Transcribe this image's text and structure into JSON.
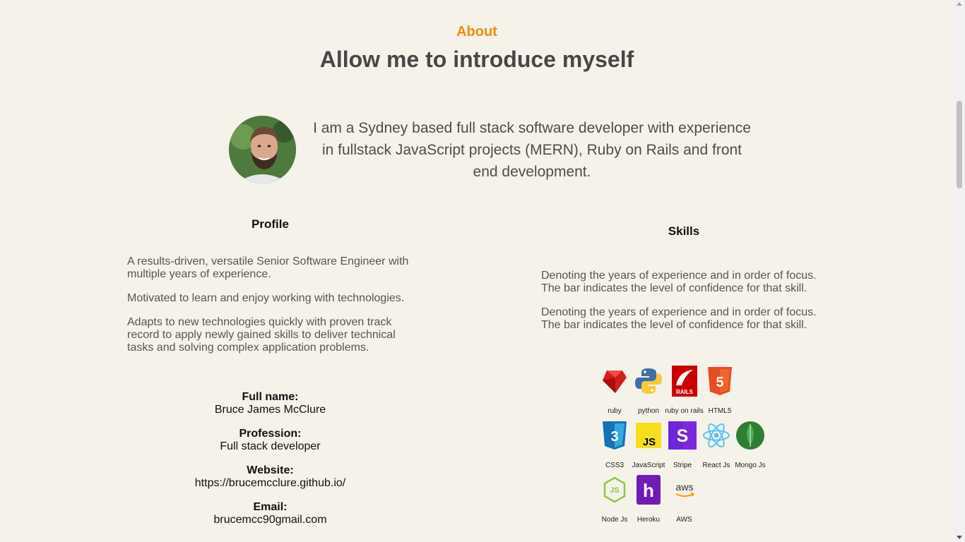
{
  "about": {
    "eyebrow": "About",
    "title": "Allow me to introduce myself",
    "intro": "I am a Sydney based full stack software developer with experience in fullstack JavaScript projects (MERN), Ruby on Rails and front end development."
  },
  "profile": {
    "heading": "Profile",
    "paragraphs": [
      "A results-driven, versatile Senior Software Engineer with multiple years of experience.",
      "Motivated to learn and enjoy working with technologies.",
      "Adapts to new technologies quickly with proven track record to apply newly gained skills to deliver technical tasks and solving complex application problems."
    ],
    "details": [
      {
        "label": "Full name:",
        "value": "Bruce James McClure"
      },
      {
        "label": "Profession:",
        "value": "Full stack developer"
      },
      {
        "label": "Website:",
        "value": "https://brucemcclure.github.io/"
      },
      {
        "label": "Email:",
        "value": "brucemcc90gmail.com"
      }
    ]
  },
  "skills": {
    "heading": "Skills",
    "paragraphs": [
      "Denoting the years of experience and in order of focus. The bar indicates the level of confidence for that skill.",
      "Denoting the years of experience and in order of focus. The bar indicates the level of confidence for that skill."
    ],
    "icons": [
      [
        "ruby",
        "python",
        "ruby on rails",
        "HTML5"
      ],
      [
        "CSS3",
        "JavaScript",
        "Stripe",
        "React Js",
        "Mongo Js"
      ],
      [
        "Node Js",
        "Heroku",
        "AWS"
      ]
    ],
    "icon_glyphs": {
      "rails": "RAILS",
      "html5": "5",
      "css3": "3",
      "js": "JS",
      "stripe": "S",
      "node": "JS",
      "heroku": "h",
      "aws": "aws"
    }
  },
  "colors": {
    "accent": "#f28c10",
    "background": "#f5f2ea"
  }
}
